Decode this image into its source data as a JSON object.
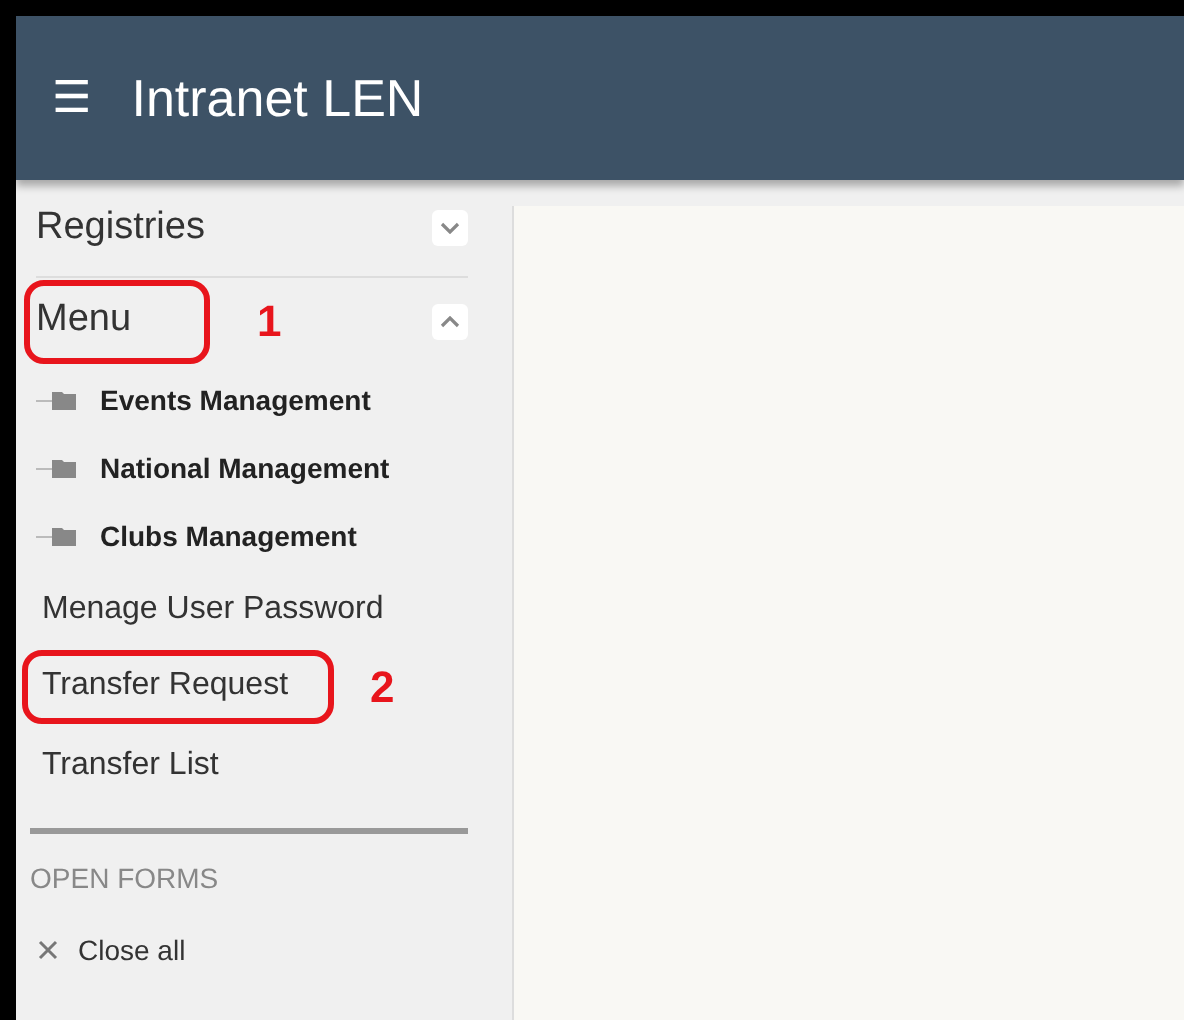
{
  "header": {
    "menu_icon": "☰",
    "title": "Intranet LEN"
  },
  "sidebar": {
    "sections": [
      {
        "label": "Registries",
        "expanded": false
      },
      {
        "label": "Menu",
        "expanded": true,
        "annotation": "1",
        "children": [
          {
            "label": "Events Management"
          },
          {
            "label": "National Management"
          },
          {
            "label": "Clubs Management"
          }
        ]
      }
    ],
    "links": [
      {
        "label": "Menage User Password"
      },
      {
        "label": "Transfer Request",
        "annotation": "2"
      },
      {
        "label": "Transfer List"
      }
    ],
    "open_forms": {
      "heading": "OPEN FORMS",
      "close_all": "Close all"
    }
  }
}
